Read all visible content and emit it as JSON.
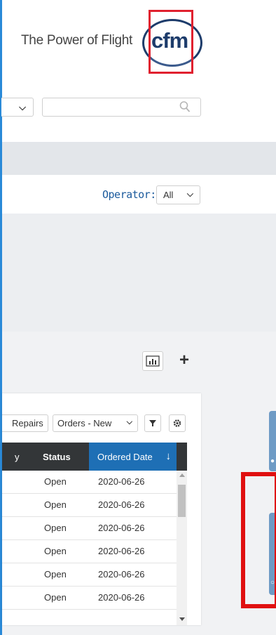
{
  "header": {
    "tagline": "The Power of Flight",
    "logo_text": "cfm"
  },
  "search": {
    "value": "",
    "placeholder": ""
  },
  "filters": {
    "operator_label": "Operator:",
    "operator_value": "All"
  },
  "toolbar": {
    "chart_icon": "bar-chart-icon",
    "add_icon": "plus-icon"
  },
  "card": {
    "chips": {
      "repairs_label": "Repairs",
      "orders_label": "Orders - New"
    },
    "table": {
      "columns": [
        "y",
        "Status",
        "Ordered Date"
      ],
      "rows": [
        {
          "status": "Open",
          "date": "2020-06-26"
        },
        {
          "status": "Open",
          "date": "2020-06-26"
        },
        {
          "status": "Open",
          "date": "2020-06-26"
        },
        {
          "status": "Open",
          "date": "2020-06-26"
        },
        {
          "status": "Open",
          "date": "2020-06-26"
        },
        {
          "status": "Open",
          "date": "2020-06-26"
        }
      ]
    }
  },
  "colors": {
    "brand_red": "#e0212f",
    "brand_navy": "#1d3c6b",
    "accent_blue": "#1e6fb5",
    "table_header": "#333638",
    "side_tab": "#6e9bc5",
    "highlight": "#e01010"
  }
}
